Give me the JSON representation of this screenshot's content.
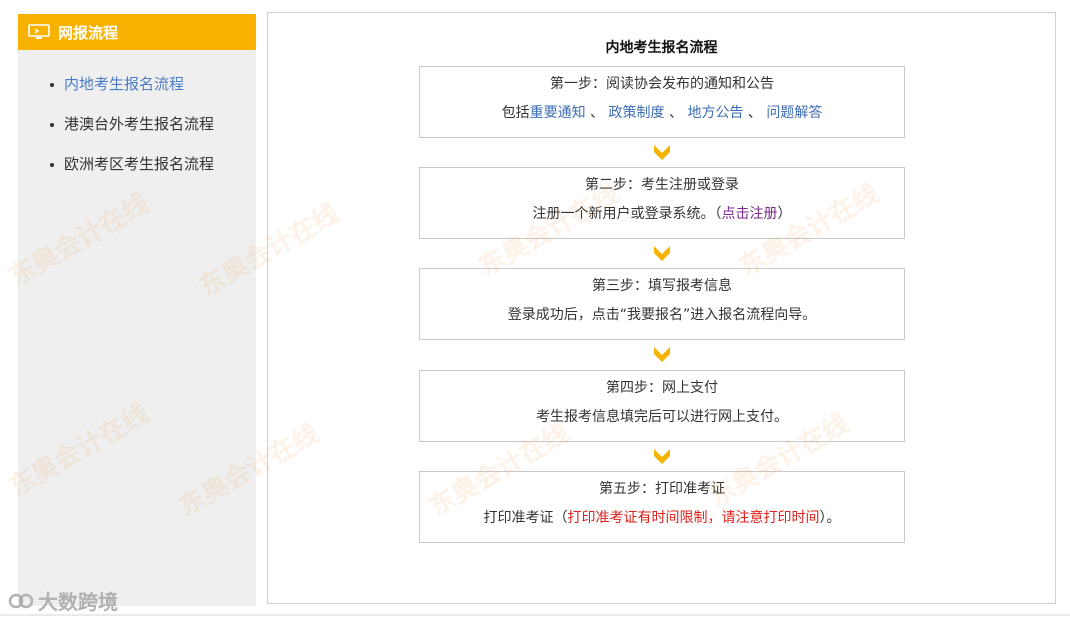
{
  "sidebar": {
    "header_title": "网报流程",
    "items": [
      {
        "label": "内地考生报名流程",
        "active": true
      },
      {
        "label": "港澳台外考生报名流程",
        "active": false
      },
      {
        "label": "欧洲考区考生报名流程",
        "active": false
      }
    ]
  },
  "flow": {
    "title": "内地考生报名流程",
    "step1": {
      "title": "第一步：阅读协会发布的通知和公告",
      "prefix": "包括",
      "link1": "重要通知",
      "sep1": "、",
      "link2": "政策制度",
      "sep2": "、",
      "link3": "地方公告",
      "sep3": "、",
      "link4": "问题解答"
    },
    "step2": {
      "title": "第二步：考生注册或登录",
      "desc": "注册一个新用户或登录系统。（",
      "link": "点击注册",
      "suffix": "）"
    },
    "step3": {
      "title": "第三步：填写报考信息",
      "desc": "登录成功后，点击“我要报名”进入报名流程向导。"
    },
    "step4": {
      "title": "第四步：网上支付",
      "desc": "考生报考信息填完后可以进行网上支付。"
    },
    "step5": {
      "title": "第五步：打印准考证",
      "prefix": "打印准考证（",
      "warning": "打印准考证有时间限制，请注意打印时间",
      "suffix": "）。"
    }
  },
  "watermark": "东奥会计在线",
  "footer_brand": "大数跨境",
  "colors": {
    "accent": "#f9b100",
    "link_blue": "#3d6eb3",
    "link_purple": "#7a2a8c",
    "warning_red": "#e0211b",
    "sidebar_bg": "#efefef"
  }
}
